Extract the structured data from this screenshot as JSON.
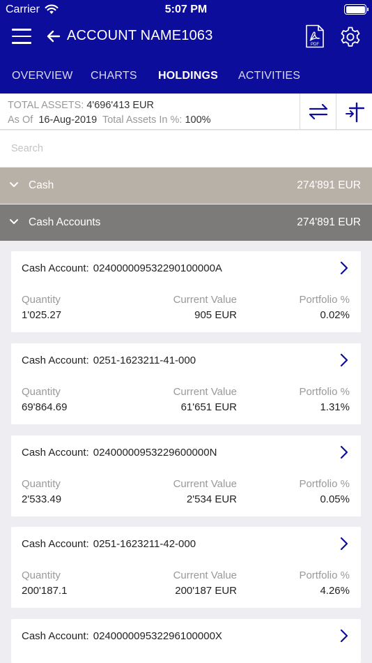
{
  "status": {
    "carrier": "Carrier",
    "time": "5:07 PM"
  },
  "header": {
    "title": "ACCOUNT NAME1063"
  },
  "tabs": [
    {
      "label": "OVERVIEW",
      "active": false
    },
    {
      "label": "CHARTS",
      "active": false
    },
    {
      "label": "HOLDINGS",
      "active": true
    },
    {
      "label": "ACTIVITIES",
      "active": false
    }
  ],
  "summary": {
    "total_assets_label": "TOTAL ASSETS:",
    "total_assets_value": "4'696'413 EUR",
    "as_of_label": "As Of",
    "as_of_date": "16-Aug-2019",
    "percent_label": "Total Assets In %:",
    "percent_value": "100%"
  },
  "search": {
    "placeholder": "Search"
  },
  "groups": [
    {
      "label": "Cash",
      "value": "274'891 EUR"
    },
    {
      "label": "Cash Accounts",
      "value": "274'891 EUR"
    }
  ],
  "card_labels": {
    "title_prefix": "Cash Account:",
    "quantity": "Quantity",
    "current_value": "Current Value",
    "portfolio": "Portfolio %"
  },
  "accounts": [
    {
      "number": "024000009532290100000A",
      "quantity": "1'025.27",
      "current_value": "905 EUR",
      "portfolio": "0.02%"
    },
    {
      "number": "0251-1623211-41-000",
      "quantity": "69'864.69",
      "current_value": "61'651 EUR",
      "portfolio": "1.31%"
    },
    {
      "number": "02400000953229600000N",
      "quantity": "2'533.49",
      "current_value": "2'534 EUR",
      "portfolio": "0.05%"
    },
    {
      "number": "0251-1623211-42-000",
      "quantity": "200'187.1",
      "current_value": "200'187 EUR",
      "portfolio": "4.26%"
    },
    {
      "number": "024000009532296100000X",
      "quantity": "",
      "current_value": "",
      "portfolio": ""
    }
  ],
  "colors": {
    "header_bg": "#0d0d9c",
    "group_cash_bg": "#b8b1a8",
    "group_accounts_bg": "#7d7b79",
    "accent": "#0d0d9c"
  },
  "icons": [
    "wifi-icon",
    "battery-icon",
    "menu-icon",
    "back-arrow-icon",
    "pdf-icon",
    "gear-icon",
    "swap-icon",
    "sort-icon",
    "chevron-down-icon",
    "chevron-right-icon"
  ]
}
